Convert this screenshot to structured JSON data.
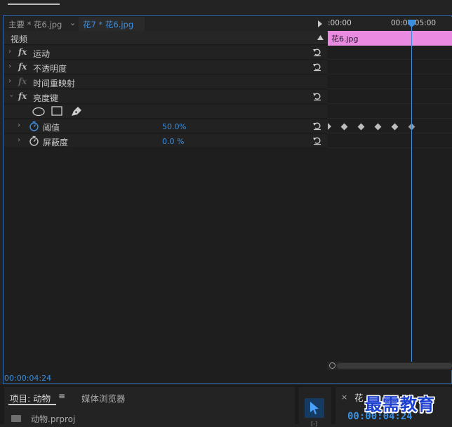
{
  "header": {
    "master_tab": "主要 * 花6.jpg",
    "clip_tab": "花7 * 花6.jpg"
  },
  "effects": {
    "section_label": "视频",
    "motion": "运动",
    "opacity": "不透明度",
    "time_remap": "时间重映射",
    "luma_key": "亮度键",
    "threshold": {
      "label": "阈值",
      "value": "50.0",
      "unit": "%"
    },
    "cutoff": {
      "label": "屏蔽度",
      "value": "0.0",
      "unit": "%"
    },
    "fx_glyph": "fx"
  },
  "timeline": {
    "tick_start": ":00:00",
    "tick_mid": "00:00:05:00",
    "clip_label": "花6.jpg"
  },
  "status": {
    "timecode": "00:00:04:24"
  },
  "bottom": {
    "project_tab": "项目: 动物",
    "project_menu": "≡",
    "media_browser_tab": "媒体浏览器",
    "project_file": "动物.prproj",
    "sequence_close": "×",
    "sequence_name": "花",
    "sequence_timecode": "00:00:04:24",
    "tools_glyph": "[-]"
  },
  "watermark": "最需教育",
  "colors": {
    "accent": "#3b8fe0",
    "clip": "#e98be0",
    "panel_border": "#2d6db5"
  },
  "icons": [
    "chevron-right-icon",
    "fx-icon",
    "reset-icon",
    "ellipse-mask-icon",
    "rectangle-mask-icon",
    "pen-mask-icon",
    "stopwatch-icon",
    "play-icon",
    "playhead-icon",
    "keyframe-icon",
    "folder-icon",
    "selection-tool-icon"
  ]
}
